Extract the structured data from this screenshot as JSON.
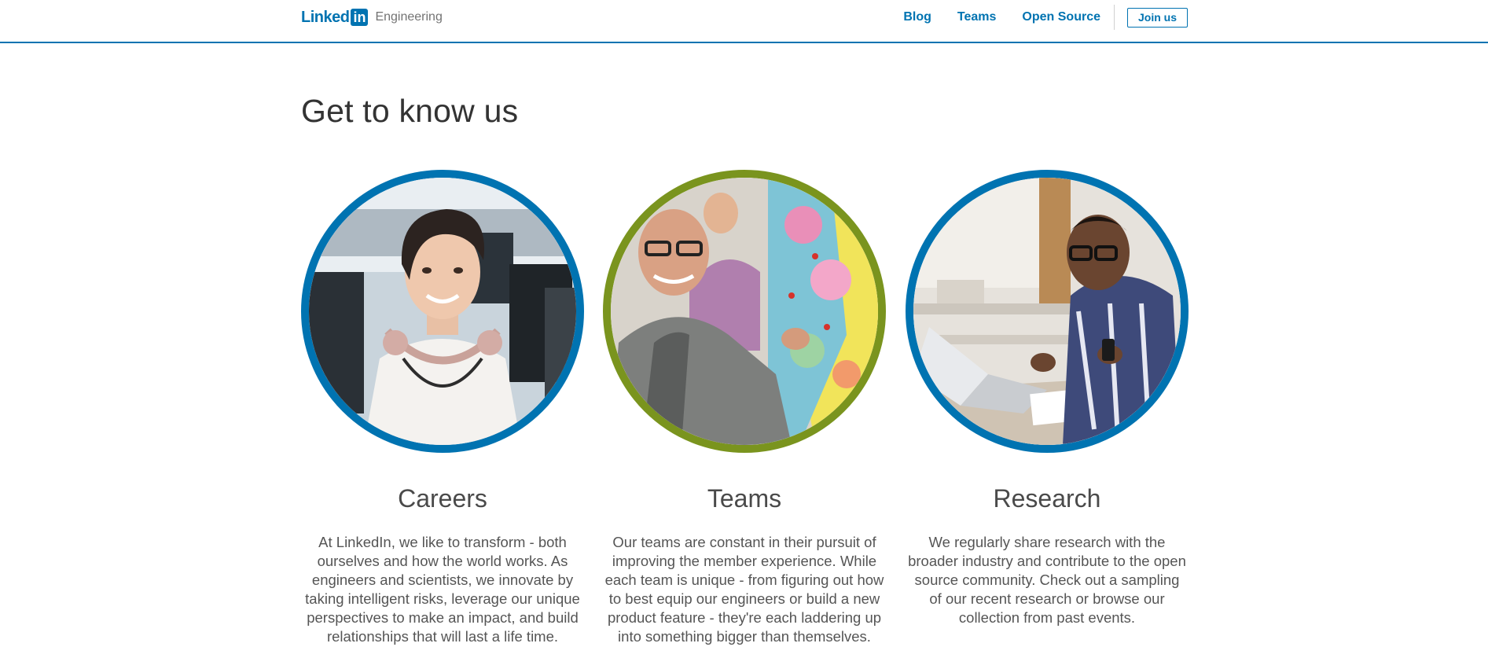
{
  "header": {
    "logo_text": "Linked",
    "logo_badge": "in",
    "brand_sub": "Engineering",
    "nav": [
      {
        "label": "Blog"
      },
      {
        "label": "Teams"
      },
      {
        "label": "Open Source"
      }
    ],
    "join_label": "Join us",
    "accent_color": "#0073b1"
  },
  "main": {
    "title": "Get to know us",
    "cards": [
      {
        "title": "Careers",
        "ring_color": "#0073b1",
        "text": "At LinkedIn, we like to transform - both ourselves and how the world works. As engineers and scientists, we innovate by taking intelligent risks, leverage our unique perspectives to make an impact, and build relationships that will last a life time."
      },
      {
        "title": "Teams",
        "ring_color": "#7a941e",
        "text": "Our teams are constant in their pursuit of improving the member experience. While each team is unique - from figuring out how to best equip our engineers or build a new product feature -  they're each laddering up into something bigger than themselves."
      },
      {
        "title": "Research",
        "ring_color": "#0073b1",
        "text": "We regularly share research with the broader industry and contribute to the open source community. Check out a sampling of our recent research or browse our collection from past events."
      }
    ]
  }
}
